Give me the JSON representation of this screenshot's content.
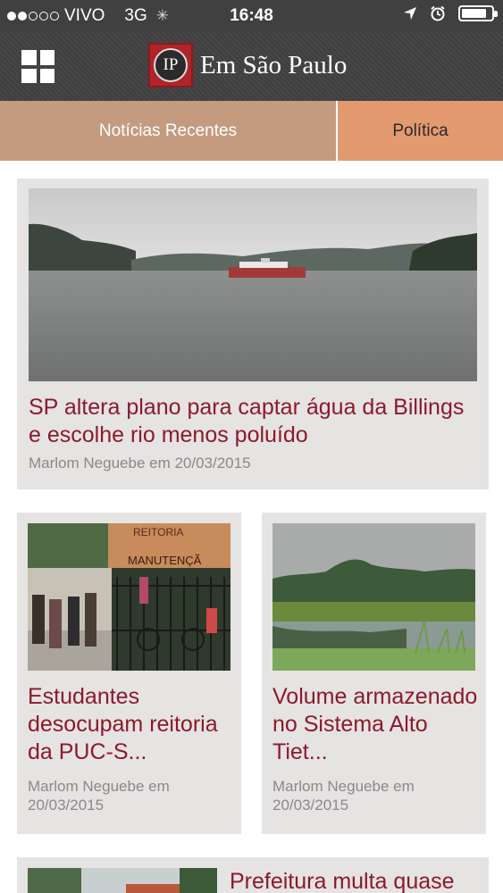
{
  "status_bar": {
    "carrier": "VIVO",
    "network": "3G",
    "time": "16:48",
    "battery_level": 0.85
  },
  "header": {
    "logo_initials": "IP",
    "app_title": "Em São Paulo",
    "colors": {
      "background": "#414141",
      "logo_red": "#b0242a"
    }
  },
  "tabs": [
    {
      "label": "Notícias Recentes",
      "active": true
    },
    {
      "label": "Política",
      "active": false
    }
  ],
  "articles": [
    {
      "title": "SP altera plano para captar água da Billings e escolhe rio menos poluído",
      "byline": "Marlom Neguebe em 20/03/2015",
      "image": "reservoir-boat-photo"
    },
    {
      "title": "Estudantes desocupam reitoria da PUC-S...",
      "byline": "Marlom Neguebe em 20/03/2015",
      "image": "protest-gate-photo",
      "sign_text": "REITORIA MANUTENÇÃ"
    },
    {
      "title": "Volume armazenado no Sistema Alto Tiet...",
      "byline": "Marlom Neguebe em 20/03/2015",
      "image": "lake-trees-photo"
    },
    {
      "title": "Prefeitura multa quase",
      "image": "building-photo"
    }
  ],
  "colors": {
    "title": "#8b1a2b",
    "byline": "#8a8888",
    "card_bg": "#e6e3e3",
    "tab_recent": "#c49b7f",
    "tab_politica": "#e39a6f"
  }
}
